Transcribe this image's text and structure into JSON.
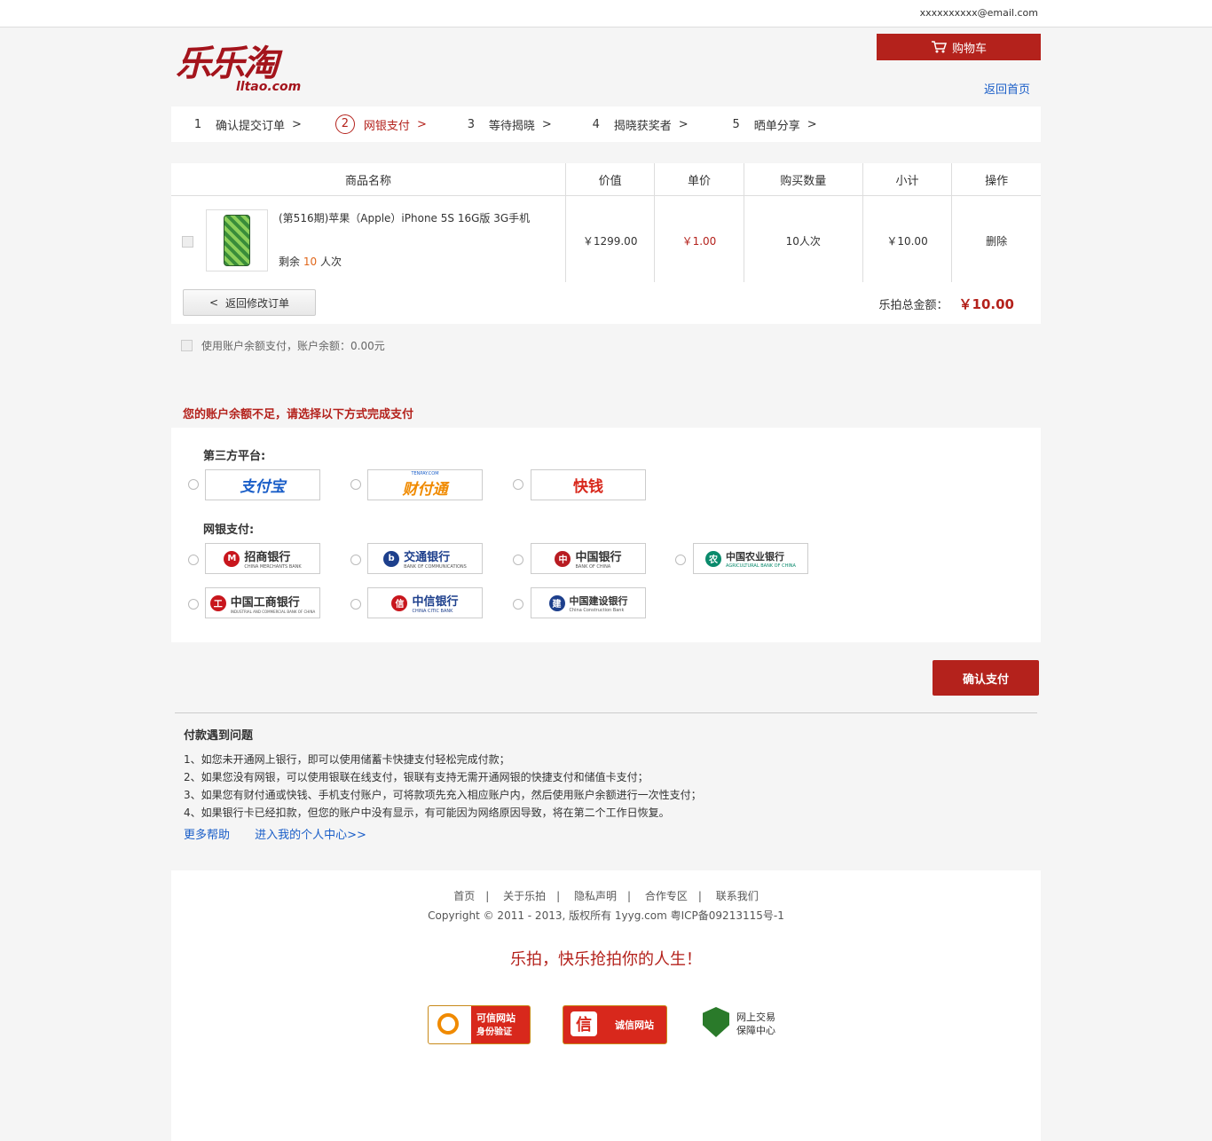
{
  "topbar": {
    "email": "xxxxxxxxxx@email.com"
  },
  "logo": {
    "cn": "乐乐淘",
    "en": "lltao.com"
  },
  "header": {
    "cart_label": "购物车",
    "back_home": "返回首页"
  },
  "steps": [
    {
      "num": "1",
      "label": "确认提交订单",
      "arrow": ">"
    },
    {
      "num": "2",
      "label": "网银支付",
      "arrow": ">"
    },
    {
      "num": "3",
      "label": "等待揭晓",
      "arrow": ">"
    },
    {
      "num": "4",
      "label": "揭晓获奖者",
      "arrow": ">"
    },
    {
      "num": "5",
      "label": "晒单分享",
      "arrow": ">"
    }
  ],
  "table": {
    "headers": [
      "商品名称",
      "价值",
      "单价",
      "购买数量",
      "小计",
      "操作"
    ],
    "row": {
      "title": "(第516期)苹果（Apple）iPhone 5S 16G版 3G手机",
      "remain_prefix": "剩余",
      "remain_count": "10",
      "remain_suffix": "人次",
      "value": "￥1299.00",
      "unit_price": "￥1.00",
      "quantity": "10人次",
      "subtotal": "￥10.00",
      "action": "删除"
    }
  },
  "summary": {
    "back_label": "返回修改订单",
    "back_arrow": "<",
    "total_label": "乐拍总金额：",
    "total_amount": "￥10.00"
  },
  "balance": {
    "label": "使用账户余额支付，账户余额：0.00元"
  },
  "notice": "您的账户余额不足，请选择以下方式完成支付",
  "payment": {
    "third_party_label": "第三方平台:",
    "bank_label": "网银支付:",
    "third_party": [
      "支付宝",
      "财付通",
      "快钱"
    ],
    "banks": [
      "招商银行",
      "交通银行",
      "中国银行",
      "中国农业银行",
      "中国工商银行",
      "中信银行",
      "中国建设银行"
    ],
    "bank_subs": [
      "CHINA MERCHANTS BANK",
      "BANK OF COMMUNICATIONS",
      "BANK OF CHINA",
      "AGRICULTURAL BANK OF CHINA",
      "INDUSTRIAL AND COMMERCIAL BANK OF CHINA",
      "CHINA CITIC BANK",
      "China Construction Bank"
    ],
    "tenpay_sub": "TENPAY.COM"
  },
  "confirm_label": "确认支付",
  "help": {
    "title": "付款遇到问题",
    "items": [
      "1、如您未开通网上银行，即可以使用储蓄卡快捷支付轻松完成付款；",
      "2、如果您没有网银，可以使用银联在线支付，银联有支持无需开通网银的快捷支付和储值卡支付；",
      "3、如果您有财付通或快钱、手机支付账户，可将款项先充入相应账户内，然后使用账户余额进行一次性支付；",
      "4、如果银行卡已经扣款，但您的账户中没有显示，有可能因为网络原因导致，将在第二个工作日恢复。"
    ],
    "more_help": "更多帮助",
    "personal_center": "进入我的个人中心>>"
  },
  "footer": {
    "nav": [
      "首页",
      "关于乐拍",
      "隐私声明",
      "合作专区",
      "联系我们"
    ],
    "separator": "|",
    "copyright": "Copyright © 2011 - 2013, 版权所有 1yyg.com 粤ICP备09213115号-1",
    "slogan": "乐拍，快乐抢拍你的人生！",
    "badges": [
      {
        "line1": "可信网站",
        "line2": "身份验证"
      },
      {
        "line1": "诚信网站",
        "line2": ""
      },
      {
        "line1": "网上交易",
        "line2": "保障中心"
      }
    ]
  },
  "colors": {
    "brand": "#b4221c",
    "link": "#1a5ec8",
    "highlight": "#e0661a"
  }
}
